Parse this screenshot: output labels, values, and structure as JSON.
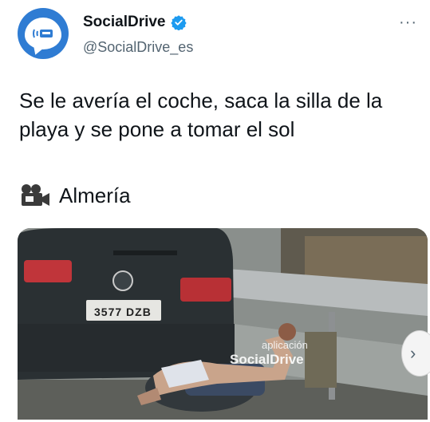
{
  "account": {
    "name": "SocialDrive",
    "handle": "@SocialDrive_es",
    "verified": true,
    "avatar_icon": "speech-bubble-road-signal-icon",
    "avatar_color": "#2f7cd3"
  },
  "more_icon": "more-dots-icon",
  "more_label": "···",
  "tweet": {
    "text": "Se le avería el coche, saca la silla de la playa y se pone a tomar el sol",
    "location_icon": "film-camera-icon",
    "location": "Almería"
  },
  "media": {
    "watermark_top": "aplicación",
    "watermark": "SocialDrive",
    "plate": "3577 DZB"
  },
  "colors": {
    "verified_badge": "#1d9bf0",
    "secondary_text": "#536471"
  }
}
